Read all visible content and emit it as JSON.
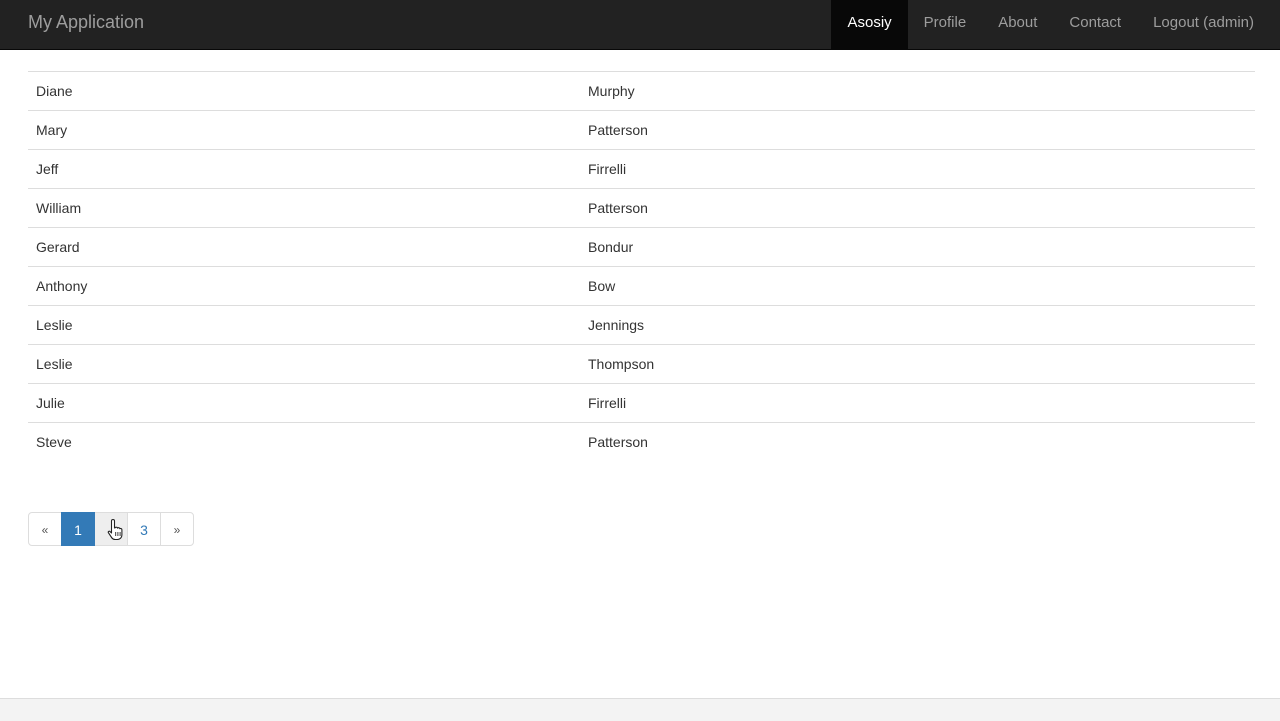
{
  "app": {
    "brand": "My Application"
  },
  "nav": {
    "items": [
      {
        "label": "Asosiy",
        "active": true
      },
      {
        "label": "Profile",
        "active": false
      },
      {
        "label": "About",
        "active": false
      },
      {
        "label": "Contact",
        "active": false
      },
      {
        "label": "Logout (admin)",
        "active": false
      }
    ]
  },
  "table": {
    "rows": [
      {
        "first": "Diane",
        "last": "Murphy"
      },
      {
        "first": "Mary",
        "last": "Patterson"
      },
      {
        "first": "Jeff",
        "last": "Firrelli"
      },
      {
        "first": "William",
        "last": "Patterson"
      },
      {
        "first": "Gerard",
        "last": "Bondur"
      },
      {
        "first": "Anthony",
        "last": "Bow"
      },
      {
        "first": "Leslie",
        "last": "Jennings"
      },
      {
        "first": "Leslie",
        "last": "Thompson"
      },
      {
        "first": "Julie",
        "last": "Firrelli"
      },
      {
        "first": "Steve",
        "last": "Patterson"
      }
    ]
  },
  "pagination": {
    "prev": "«",
    "pages": [
      "1",
      "",
      "3"
    ],
    "current": "1",
    "next": "»"
  },
  "colors": {
    "navbar": "#222222",
    "nav_active": "#080808",
    "accent": "#337ab7"
  }
}
